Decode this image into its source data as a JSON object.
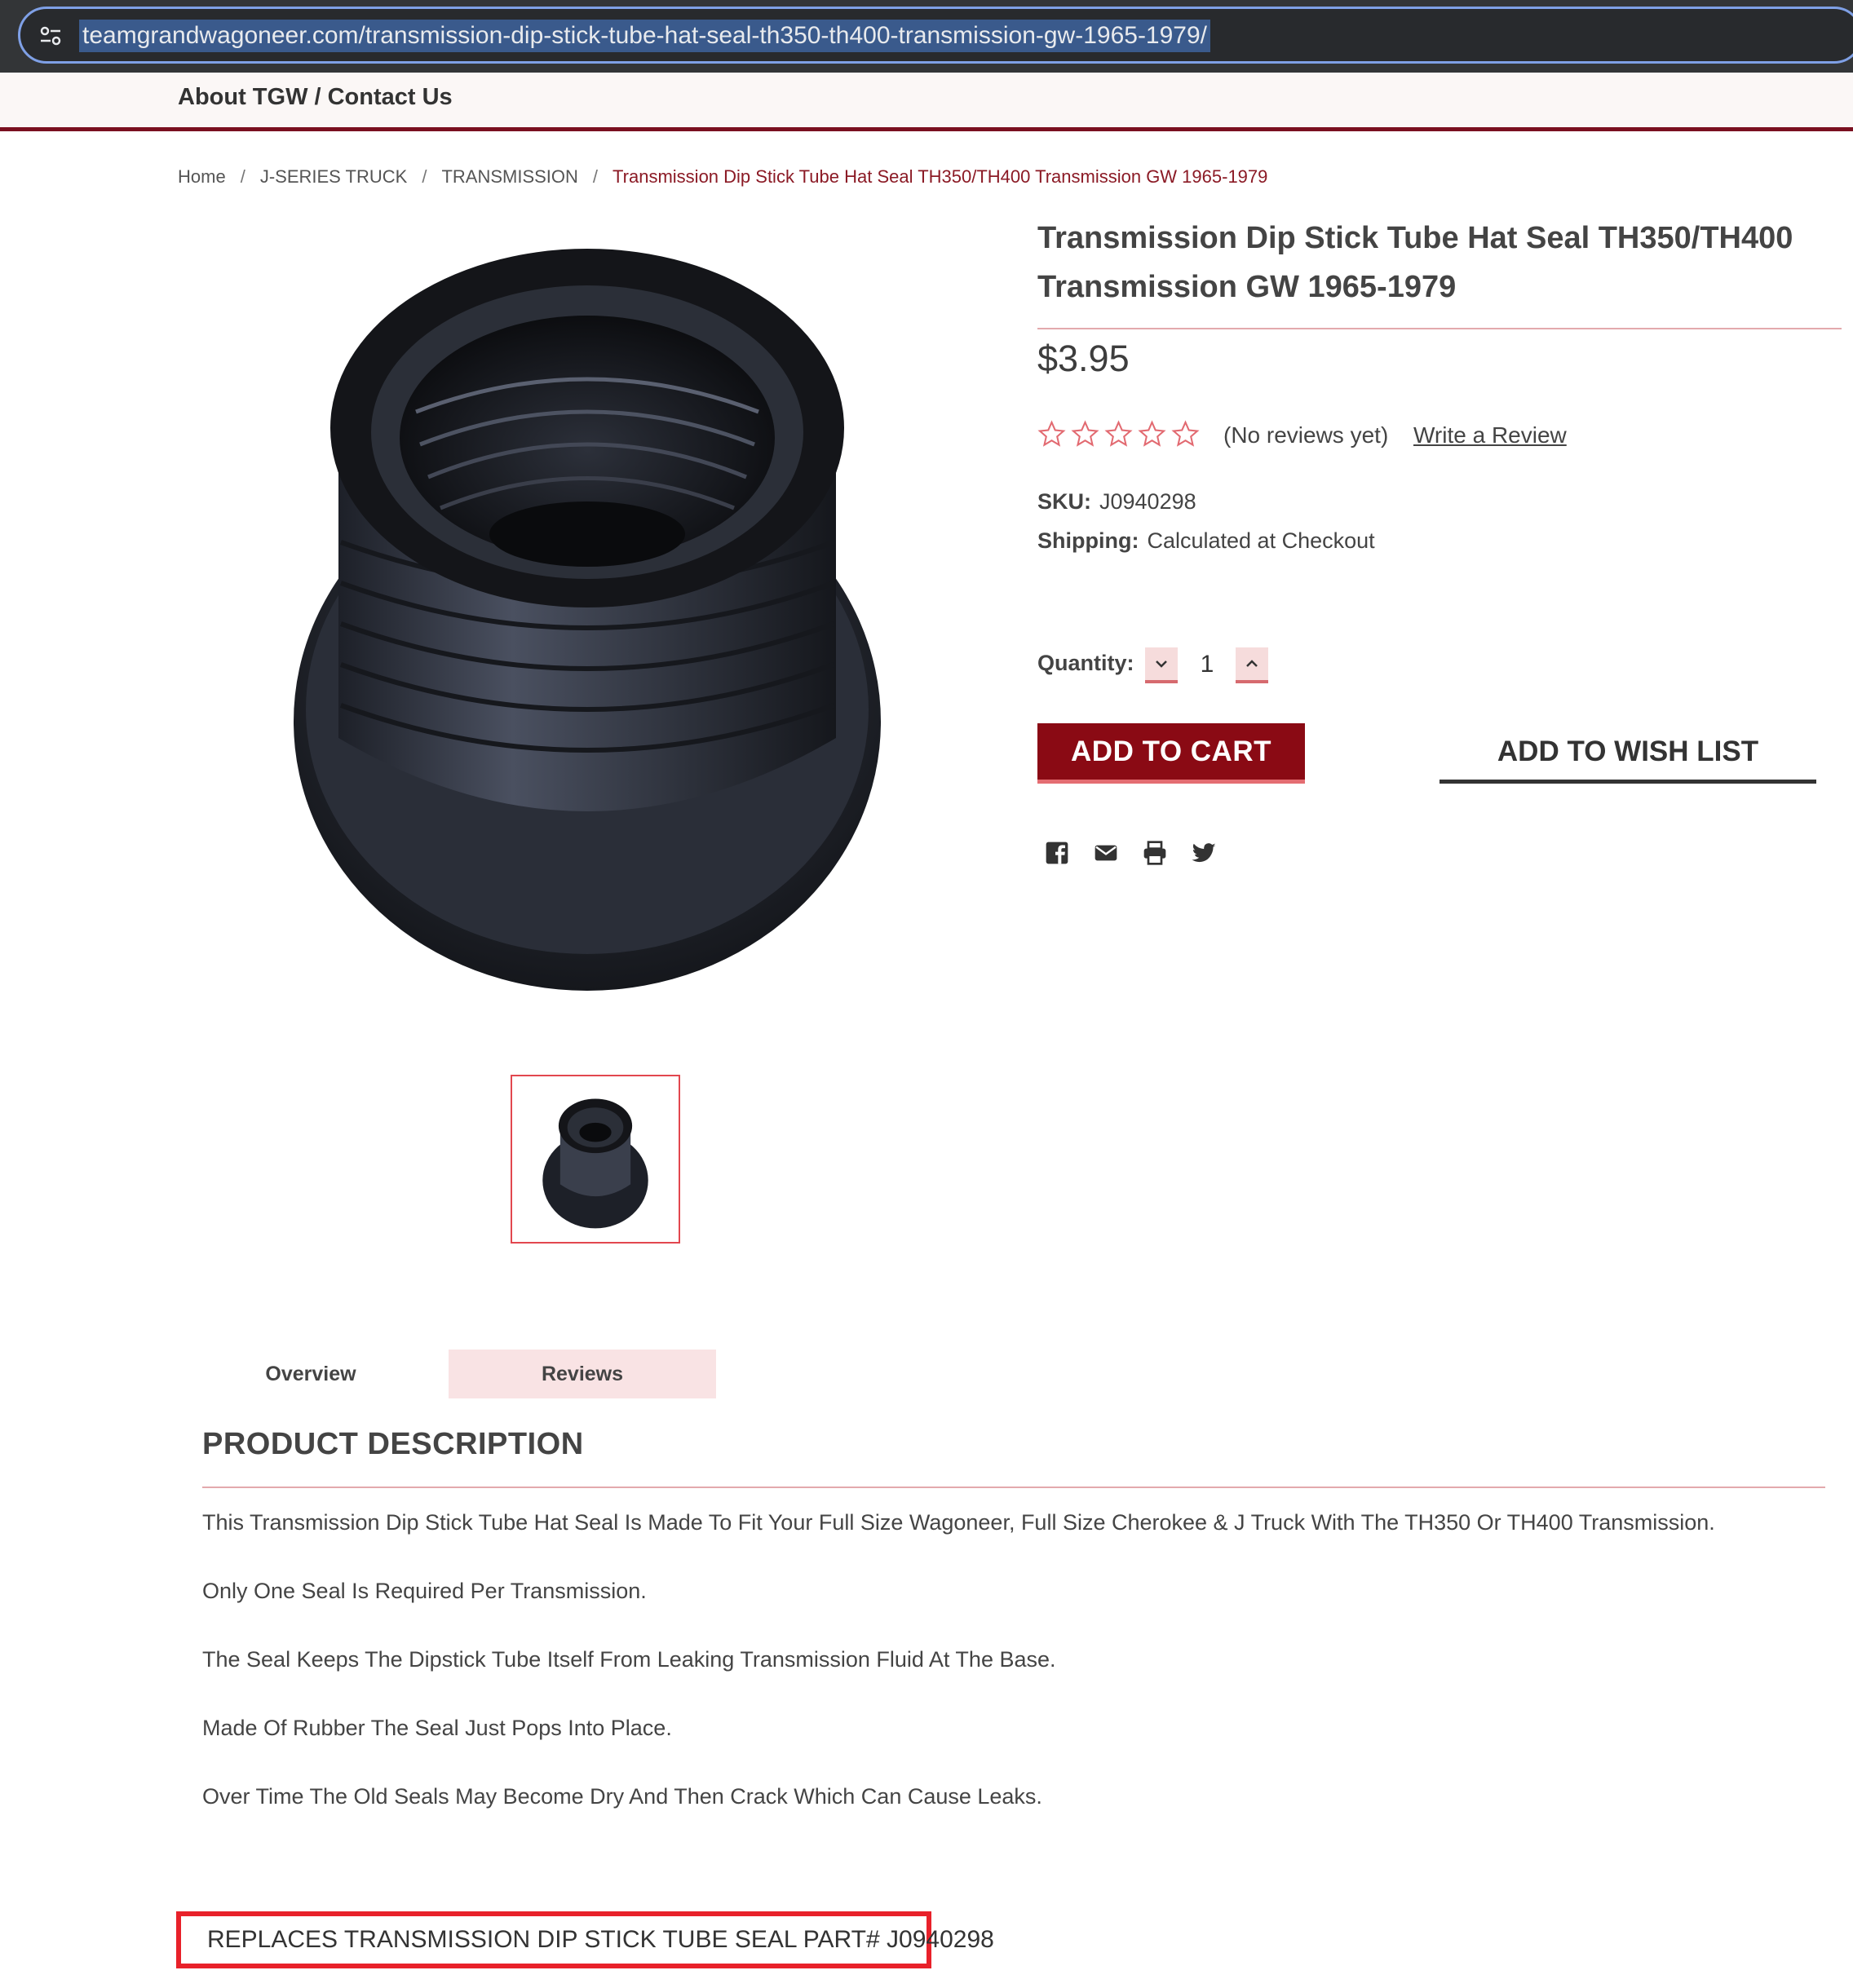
{
  "browser": {
    "url": "teamgrandwagoneer.com/transmission-dip-stick-tube-hat-seal-th350-th400-transmission-gw-1965-1979/"
  },
  "header": {
    "nav_label": "About TGW / Contact Us"
  },
  "breadcrumb": {
    "items": [
      "Home",
      "J-SERIES TRUCK",
      "TRANSMISSION"
    ],
    "separator": "/",
    "current": "Transmission Dip Stick Tube Hat Seal TH350/TH400 Transmission GW 1965-1979"
  },
  "product": {
    "title": "Transmission Dip Stick Tube Hat Seal TH350/TH400 Transmission GW 1965-1979",
    "price": "$3.95",
    "rating": {
      "filled": 0,
      "max": 5
    },
    "reviews_text": "(No reviews yet)",
    "write_review": "Write a Review",
    "sku_label": "SKU:",
    "sku": "J0940298",
    "shipping_label": "Shipping:",
    "shipping": "Calculated at Checkout",
    "quantity_label": "Quantity:",
    "quantity": "1",
    "add_to_cart": "ADD TO CART",
    "add_to_wish_list": "ADD TO WISH LIST"
  },
  "share_icons": [
    "facebook-icon",
    "email-icon",
    "print-icon",
    "twitter-icon"
  ],
  "tabs": [
    {
      "label": "Overview"
    },
    {
      "label": "Reviews"
    }
  ],
  "description": {
    "heading": "PRODUCT DESCRIPTION",
    "paragraphs": [
      "This Transmission Dip Stick Tube Hat Seal Is Made To Fit Your Full Size Wagoneer, Full Size Cherokee & J Truck With The TH350 Or TH400 Transmission.",
      "Only One Seal Is Required Per Transmission.",
      "The Seal Keeps The Dipstick Tube Itself From Leaking Transmission Fluid At The Base.",
      "Made Of Rubber The Seal Just Pops Into Place.",
      "Over Time The Old Seals May Become Dry And Then Crack Which Can Cause Leaks."
    ],
    "replaces_note": "REPLACES TRANSMISSION DIP STICK TUBE SEAL PART# J0940298"
  },
  "colors": {
    "brand_red": "#8a0a14",
    "accent_pink": "#e46d72",
    "highlight_box": "#e8212a"
  }
}
